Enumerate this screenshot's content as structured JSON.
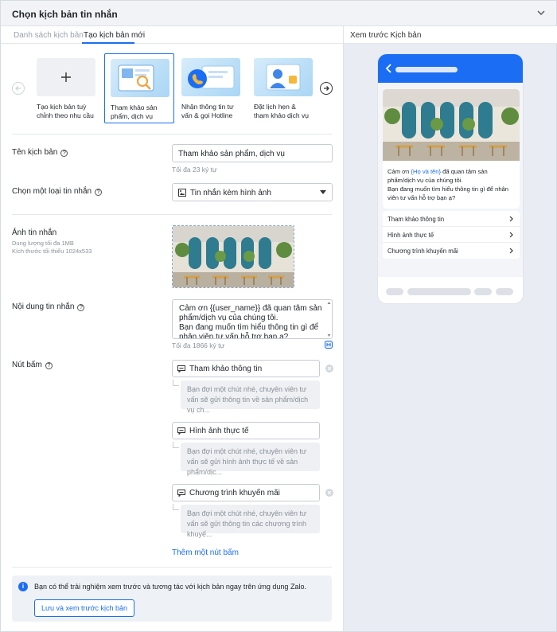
{
  "window": {
    "title": "Chọn kịch bản tin nhắn"
  },
  "tabs": [
    {
      "label": "Danh sách kịch bản",
      "active": false
    },
    {
      "label": "Tạo kịch bản mới",
      "active": true
    }
  ],
  "templates": [
    {
      "label": "Tạo kịch bản tuỳ chỉnh theo nhu cầu",
      "icon": "plus-icon"
    },
    {
      "label": "Tham khảo sản phẩm, dịch vụ",
      "icon": "search-product-icon",
      "selected": true
    },
    {
      "label": "Nhận thông tin tư vấn & gọi Hotline",
      "icon": "phone-icon"
    },
    {
      "label": "Đặt lịch hẹn & tham khảo dịch vụ",
      "icon": "calendar-user-icon"
    }
  ],
  "form": {
    "name_label": "Tên kịch bản",
    "name_value": "Tham khảo sản phẩm, dịch vụ",
    "name_hint": "Tối đa 23 ký tự",
    "type_label": "Chọn một loại tin nhắn",
    "type_value": "Tin nhắn kèm hình ảnh",
    "image_label": "Ảnh tin nhắn",
    "image_sub1": "Dung lượng tối đa 1MB",
    "image_sub2": "Kích thước tối thiểu 1024x533",
    "content_label": "Nội dung tin nhắn",
    "content_value": "Cảm ơn {{user_name}} đã quan tâm sản phẩm/dịch vụ của chúng tôi.\nBạn đang muốn tìm hiểu thông tin gì để nhân viên tư vấn hỗ trợ bạn ạ?",
    "content_hint": "Tối đa 1866 ký tự",
    "buttons_label": "Nút bấm",
    "buttons": [
      {
        "label": "Tham khảo thông tin",
        "reply": "Bạn đợi một chút nhé, chuyên viên tư vấn sẽ gửi thông tin về sản phẩm/dịch vụ ch..."
      },
      {
        "label": "Hình ảnh thực tế",
        "reply": "Bạn đợi một chút nhé, chuyên viên tư vấn sẽ gửi hình ảnh thực tế về sản phẩm/dịc..."
      },
      {
        "label": "Chương trình khuyến mãi",
        "reply": "Bạn đợi một chút nhé, chuyên viên tư vấn sẽ gửi thông tin các chương trình khuyế..."
      }
    ],
    "add_button": "Thêm một nút bấm"
  },
  "info": {
    "text": "Bạn có thể trải nghiệm xem trước và tương tác với kịch bản ngay trên ứng dụng Zalo.",
    "button": "Lưu và xem trước kịch bản"
  },
  "preview": {
    "title": "Xem trước Kịch bản",
    "msg_prefix": "Cảm ơn ",
    "msg_name": "{Họ và tên}",
    "msg_rest": " đã quan tâm sản phẩm/dịch vụ của chúng tôi.",
    "msg_line2": "Bạn đang muốn tìm hiểu thông tin gì để nhân viên tư vấn hỗ trợ bạn ạ?",
    "buttons": [
      "Tham khảo thông tin",
      "Hình ảnh thực tế",
      "Chương trình khuyến mãi"
    ]
  },
  "colors": {
    "accent": "#1b6ef3",
    "panel": "#e9edf3"
  }
}
